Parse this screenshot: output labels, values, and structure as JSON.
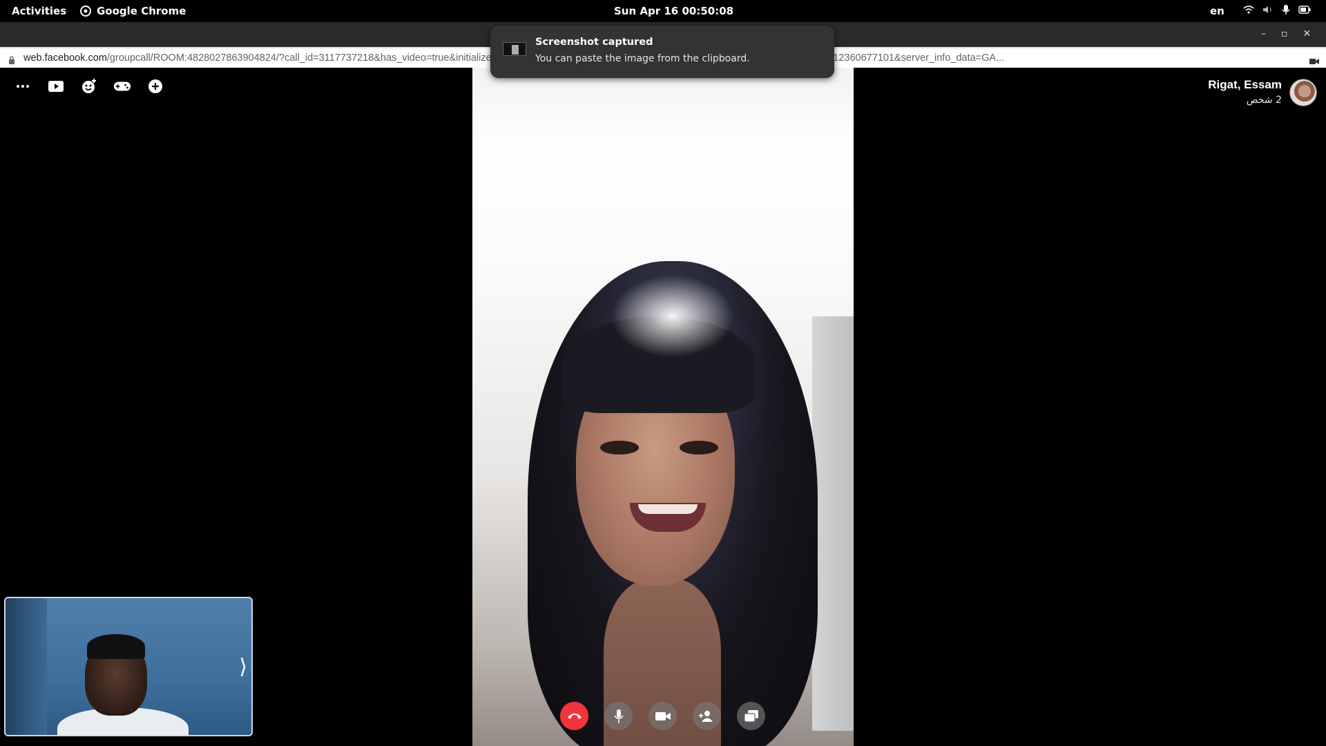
{
  "system_bar": {
    "activities": "Activities",
    "app_name": "Google Chrome",
    "clock": "Sun Apr 16  00:50:08",
    "language": "en"
  },
  "browser": {
    "url_host": "web.facebook.com",
    "url_path": "/groupcall/ROOM:4828027863904824/?call_id=3117737218&has_video=true&initialize_vid...o_ring[0]=100012360677101&use_joining_context=true&peer_id=100012360677101&server_info_data=GA..."
  },
  "notification": {
    "title": "Screenshot captured",
    "body": "You can paste the image from the clipboard."
  },
  "call": {
    "participants_names": "Rigat, Essam",
    "participants_count": "2 شخص",
    "self_view_toggle": "⟩"
  },
  "toolbar_icons": [
    "more-icon",
    "share-screen-icon",
    "effects-icon",
    "games-icon",
    "add-icon"
  ],
  "controls": [
    "end-call",
    "microphone",
    "camera",
    "add-person",
    "share-screen"
  ],
  "colors": {
    "end_call": "#f0353d",
    "background": "#000000"
  }
}
